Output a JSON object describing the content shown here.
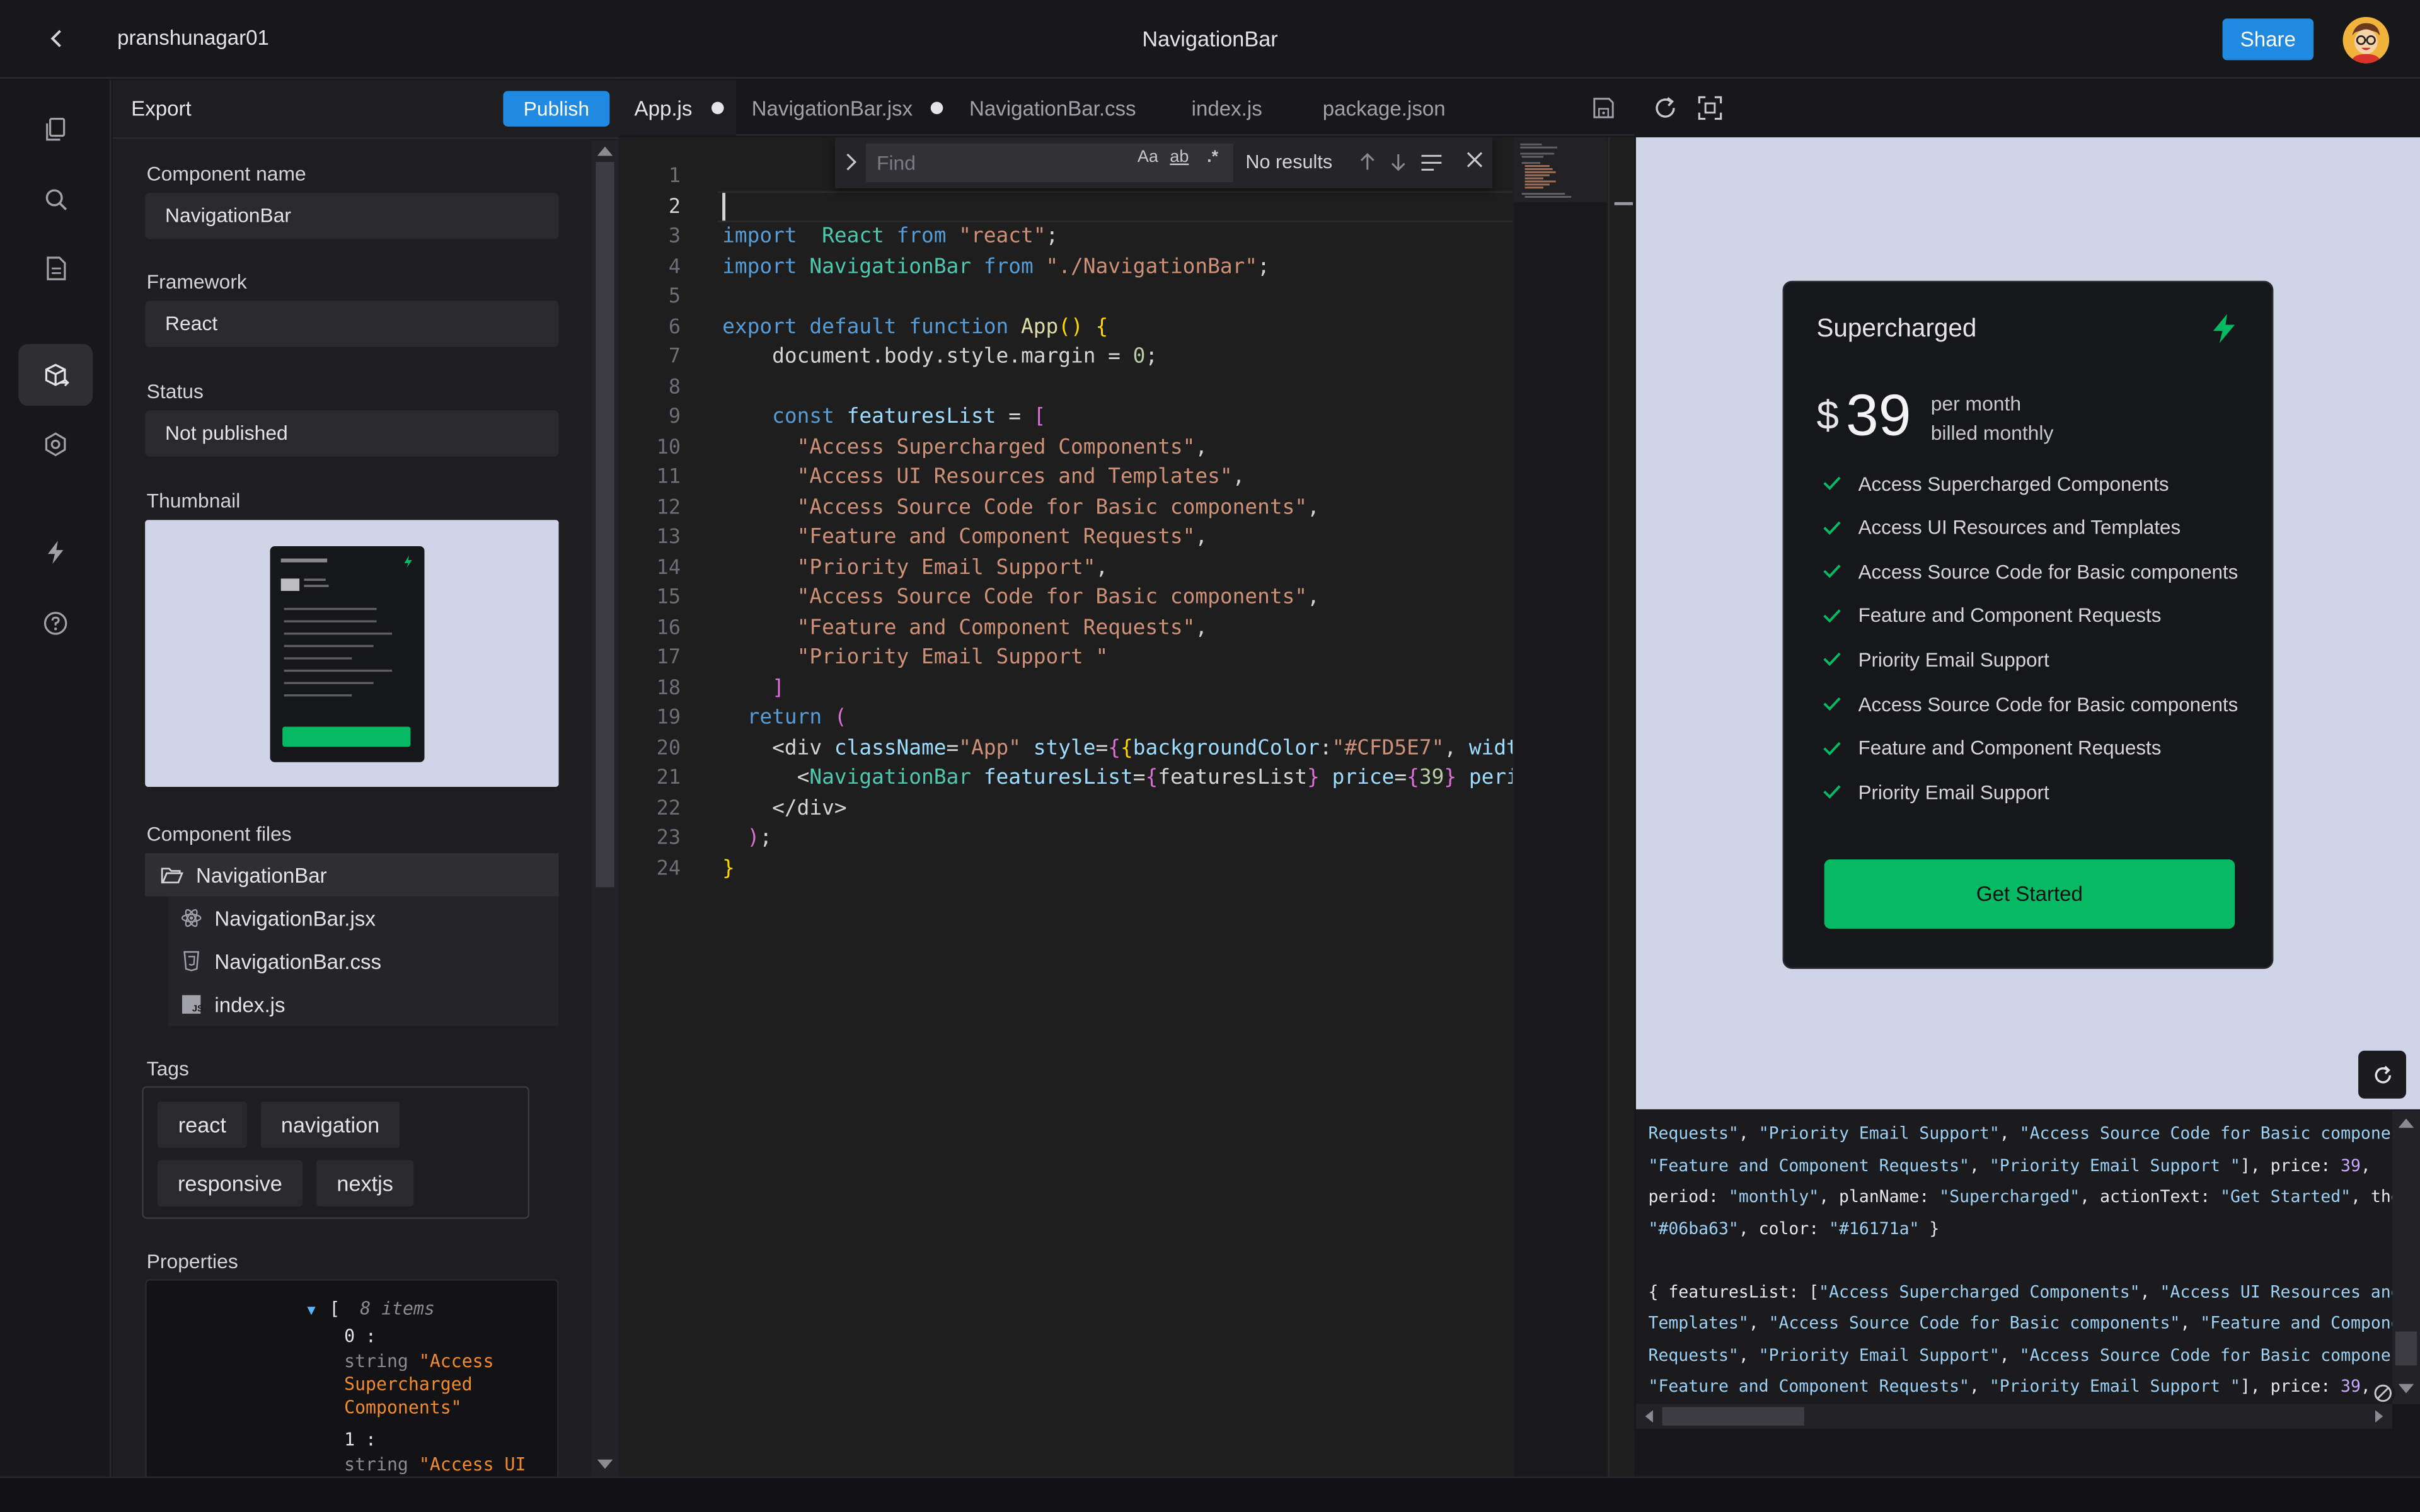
{
  "header": {
    "owner": "pranshunagar01",
    "title": "NavigationBar",
    "share_label": "Share"
  },
  "rail": {
    "icons": [
      "files-icon",
      "search-icon",
      "document-icon",
      "package-export-icon",
      "settings-icon",
      "bolt-icon",
      "help-icon"
    ]
  },
  "export_panel": {
    "title": "Export",
    "publish_label": "Publish",
    "component_name_label": "Component name",
    "component_name": "NavigationBar",
    "framework_label": "Framework",
    "framework": "React",
    "status_label": "Status",
    "status": "Not published",
    "thumbnail_label": "Thumbnail",
    "files_label": "Component files",
    "folder": "NavigationBar",
    "files": [
      "NavigationBar.jsx",
      "NavigationBar.css",
      "index.js"
    ],
    "tags_label": "Tags",
    "tags": [
      "react",
      "navigation",
      "responsive",
      "nextjs"
    ],
    "properties_label": "Properties",
    "properties": {
      "bracket": "[",
      "count": "8 items",
      "item0_index": "0 :",
      "item0_type": "string",
      "item0_value_l1": "\"Access",
      "item0_value_l2": "Supercharged",
      "item0_value_l3": "Components\"",
      "item1_index": "1 :",
      "item1_type": "string",
      "item1_value": "\"Access UI"
    }
  },
  "tabs": [
    {
      "label": "App.js",
      "modified": true
    },
    {
      "label": "NavigationBar.jsx",
      "modified": true
    },
    {
      "label": "NavigationBar.css",
      "modified": false
    },
    {
      "label": "index.js",
      "modified": false
    },
    {
      "label": "package.json",
      "modified": false
    }
  ],
  "find": {
    "placeholder": "Find",
    "match_case": "Aa",
    "whole_word": "ab",
    "regex": ".*",
    "result": "No results"
  },
  "code": {
    "line_numbers": [
      "1",
      "2",
      "3",
      "4",
      "5",
      "6",
      "7",
      "8",
      "9",
      "10",
      "11",
      "12",
      "13",
      "14",
      "15",
      "16",
      "17",
      "18",
      "19",
      "20",
      "21",
      "22",
      "23",
      "24"
    ],
    "lines": [
      [],
      [],
      [
        [
          "kw",
          "import"
        ],
        [
          "",
          "  "
        ],
        [
          "cn",
          "React"
        ],
        [
          "",
          " "
        ],
        [
          "kw",
          "from"
        ],
        [
          "",
          " "
        ],
        [
          "st",
          "\"react\""
        ],
        [
          "",
          ";"
        ]
      ],
      [
        [
          "kw",
          "import"
        ],
        [
          "",
          " "
        ],
        [
          "cn",
          "NavigationBar"
        ],
        [
          "",
          " "
        ],
        [
          "kw",
          "from"
        ],
        [
          "",
          " "
        ],
        [
          "st",
          "\"./NavigationBar\""
        ],
        [
          "",
          ";"
        ]
      ],
      [],
      [
        [
          "kw",
          "export"
        ],
        [
          "",
          " "
        ],
        [
          "kw",
          "default"
        ],
        [
          "",
          " "
        ],
        [
          "kw",
          "function"
        ],
        [
          "",
          " "
        ],
        [
          "fn",
          "App"
        ],
        [
          "by",
          "()"
        ],
        [
          "",
          " "
        ],
        [
          "by",
          "{"
        ]
      ],
      [
        [
          "",
          "    document.body.style.margin = "
        ],
        [
          "nu",
          "0"
        ],
        [
          "",
          ";"
        ]
      ],
      [],
      [
        [
          "",
          "    "
        ],
        [
          "kw",
          "const"
        ],
        [
          "at",
          " featuresList"
        ],
        [
          "",
          " = "
        ],
        [
          "br",
          "["
        ]
      ],
      [
        [
          "",
          "      "
        ],
        [
          "st",
          "\"Access Supercharged Components\""
        ],
        [
          "",
          ","
        ]
      ],
      [
        [
          "",
          "      "
        ],
        [
          "st",
          "\"Access UI Resources and Templates\""
        ],
        [
          "",
          ","
        ]
      ],
      [
        [
          "",
          "      "
        ],
        [
          "st",
          "\"Access Source Code for Basic components\""
        ],
        [
          "",
          ","
        ]
      ],
      [
        [
          "",
          "      "
        ],
        [
          "st",
          "\"Feature and Component Requests\""
        ],
        [
          "",
          ","
        ]
      ],
      [
        [
          "",
          "      "
        ],
        [
          "st",
          "\"Priority Email Support\""
        ],
        [
          "",
          ","
        ]
      ],
      [
        [
          "",
          "      "
        ],
        [
          "st",
          "\"Access Source Code for Basic components\""
        ],
        [
          "",
          ","
        ]
      ],
      [
        [
          "",
          "      "
        ],
        [
          "st",
          "\"Feature and Component Requests\""
        ],
        [
          "",
          ","
        ]
      ],
      [
        [
          "",
          "      "
        ],
        [
          "st",
          "\"Priority Email Support \""
        ]
      ],
      [
        [
          "",
          "    "
        ],
        [
          "br",
          "]"
        ]
      ],
      [
        [
          "",
          "  "
        ],
        [
          "kw",
          "return"
        ],
        [
          "",
          " "
        ],
        [
          "br",
          "("
        ]
      ],
      [
        [
          "",
          "    <div "
        ],
        [
          "at",
          "className"
        ],
        [
          "",
          "="
        ],
        [
          "st",
          "\"App\""
        ],
        [
          "",
          " "
        ],
        [
          "at",
          "style"
        ],
        [
          "",
          "="
        ],
        [
          "br",
          "{"
        ],
        [
          "by",
          "{"
        ],
        [
          "at",
          "backgroundColor"
        ],
        [
          "",
          ":"
        ],
        [
          "st",
          "\"#CFD5E7\""
        ],
        [
          "",
          ", "
        ],
        [
          "at",
          "width"
        ],
        [
          "",
          ":"
        ]
      ],
      [
        [
          "",
          "      <"
        ],
        [
          "cn",
          "NavigationBar"
        ],
        [
          "",
          " "
        ],
        [
          "at",
          "featuresList"
        ],
        [
          "",
          "="
        ],
        [
          "br",
          "{"
        ],
        [
          "",
          "featuresList"
        ],
        [
          "br",
          "}"
        ],
        [
          "",
          " "
        ],
        [
          "at",
          "price"
        ],
        [
          "",
          "="
        ],
        [
          "br",
          "{"
        ],
        [
          "nu",
          "39"
        ],
        [
          "br",
          "}"
        ],
        [
          "",
          " "
        ],
        [
          "at",
          "period"
        ]
      ],
      [
        [
          "",
          "    </div>"
        ]
      ],
      [
        [
          "",
          "  "
        ],
        [
          "br",
          ")"
        ],
        [
          "",
          ";"
        ]
      ],
      [
        [
          "by",
          "}"
        ]
      ]
    ]
  },
  "preview": {
    "plan_name": "Supercharged",
    "currency": "$",
    "price": "39",
    "period_line1": "per month",
    "period_line2": "billed monthly",
    "features": [
      "Access Supercharged Components",
      "Access UI Resources and Templates",
      "Access Source Code for Basic components",
      "Feature and Component Requests",
      "Priority Email Support",
      "Access Source Code for Basic components",
      "Feature and Component Requests",
      "Priority Email Support"
    ],
    "action_text": "Get Started",
    "theme_color": "#06ba63",
    "card_color": "#16171a",
    "background_color": "#CFD5E7"
  },
  "console": {
    "lines": [
      [
        [
          "s",
          "Requests\""
        ],
        [
          "k",
          ", "
        ],
        [
          "s",
          "\"Priority Email Support\""
        ],
        [
          "k",
          ", "
        ],
        [
          "s",
          "\"Access Source Code for Basic components\""
        ],
        [
          "k",
          ","
        ]
      ],
      [
        [
          "s",
          "\"Feature and Component Requests\""
        ],
        [
          "k",
          ", "
        ],
        [
          "s",
          "\"Priority Email Support \""
        ],
        [
          "k",
          "], price: "
        ],
        [
          "n",
          "39"
        ],
        [
          "k",
          ","
        ]
      ],
      [
        [
          "k",
          "period: "
        ],
        [
          "s",
          "\"monthly\""
        ],
        [
          "k",
          ", planName: "
        ],
        [
          "s",
          "\"Supercharged\""
        ],
        [
          "k",
          ", actionText: "
        ],
        [
          "s",
          "\"Get Started\""
        ],
        [
          "k",
          ", theme:"
        ]
      ],
      [
        [
          "s",
          "\"#06ba63\""
        ],
        [
          "k",
          ", color: "
        ],
        [
          "s",
          "\"#16171a\""
        ],
        [
          "k",
          " }"
        ]
      ],
      [],
      [
        [
          "k",
          "{ featuresList: ["
        ],
        [
          "s",
          "\"Access Supercharged Components\""
        ],
        [
          "k",
          ", "
        ],
        [
          "s",
          "\"Access UI Resources and"
        ]
      ],
      [
        [
          "s",
          "Templates\""
        ],
        [
          "k",
          ", "
        ],
        [
          "s",
          "\"Access Source Code for Basic components\""
        ],
        [
          "k",
          ", "
        ],
        [
          "s",
          "\"Feature and Component"
        ]
      ],
      [
        [
          "s",
          "Requests\""
        ],
        [
          "k",
          ", "
        ],
        [
          "s",
          "\"Priority Email Support\""
        ],
        [
          "k",
          ", "
        ],
        [
          "s",
          "\"Access Source Code for Basic components\""
        ],
        [
          "k",
          ","
        ]
      ],
      [
        [
          "s",
          "\"Feature and Component Requests\""
        ],
        [
          "k",
          ", "
        ],
        [
          "s",
          "\"Priority Email Support \""
        ],
        [
          "k",
          "], price: "
        ],
        [
          "n",
          "39"
        ],
        [
          "k",
          ","
        ]
      ]
    ]
  }
}
